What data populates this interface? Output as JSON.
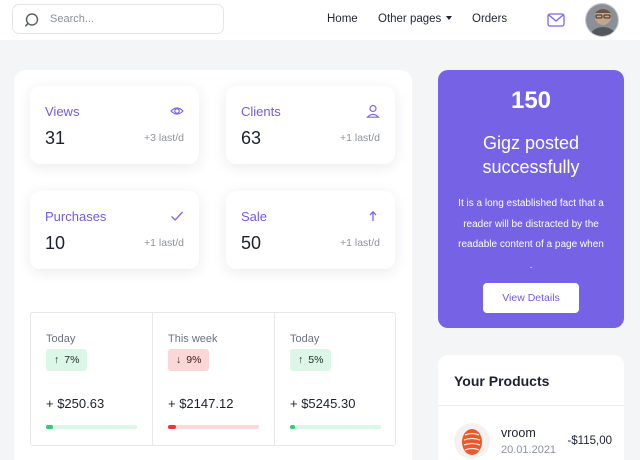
{
  "header": {
    "search_placeholder": "Search...",
    "nav": [
      "Home",
      "Other pages",
      "Orders"
    ]
  },
  "stats": [
    {
      "title": "Views",
      "value": "31",
      "delta": "+3 last/d",
      "icon": "eye-icon"
    },
    {
      "title": "Clients",
      "value": "63",
      "delta": "+1 last/d",
      "icon": "user-icon"
    },
    {
      "title": "Purchases",
      "value": "10",
      "delta": "+1 last/d",
      "icon": "check-icon"
    },
    {
      "title": "Sale",
      "value": "50",
      "delta": "+1 last/d",
      "icon": "arrow-up-icon"
    }
  ],
  "metrics": [
    {
      "period": "Today",
      "direction": "up",
      "arrow": "↑",
      "change": "7%",
      "amount": "+ $250.63",
      "progress": 0.08,
      "color": "#2ecc71",
      "track": "#daf6e6"
    },
    {
      "period": "This week",
      "direction": "down",
      "arrow": "↓",
      "change": "9%",
      "amount": "+ $2147.12",
      "progress": 0.09,
      "color": "#e53935",
      "track": "#fbd9d9"
    },
    {
      "period": "Today",
      "direction": "up",
      "arrow": "↑",
      "change": "5%",
      "amount": "+ $5245.30",
      "progress": 0.06,
      "color": "#2ecc71",
      "track": "#daf6e6"
    }
  ],
  "promo": {
    "count": "150",
    "headline": "Gigz posted successfully",
    "description": "It is a long established fact that a reader will be distracted by the readable content of a page when .",
    "button": "View Details"
  },
  "products": {
    "title": "Your Products",
    "items": [
      {
        "name": "vroom",
        "date": "20.01.2021",
        "price": "-$115,00"
      }
    ]
  },
  "colors": {
    "accent": "#7562e4",
    "background": "#f4f5f7"
  }
}
